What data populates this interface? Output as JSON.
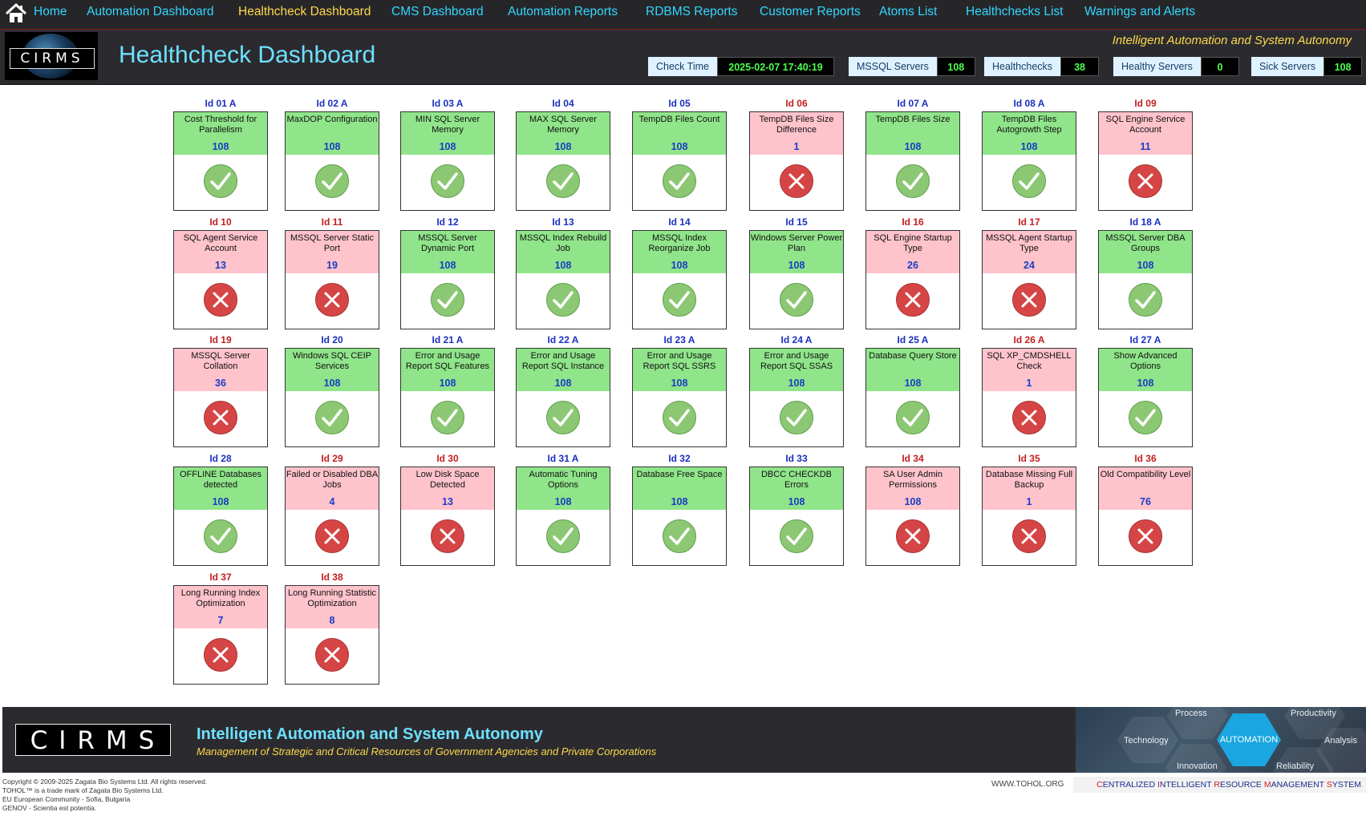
{
  "nav": {
    "items": [
      {
        "label": "Home",
        "active": false
      },
      {
        "label": "Automation Dashboard",
        "active": false
      },
      {
        "label": "Healthcheck Dashboard",
        "active": true
      },
      {
        "label": "CMS Dashboard",
        "active": false
      },
      {
        "label": "Automation Reports",
        "active": false
      },
      {
        "label": "RDBMS Reports",
        "active": false
      },
      {
        "label": "Customer Reports",
        "active": false
      },
      {
        "label": "Atoms List",
        "active": false
      },
      {
        "label": "Healthchecks List",
        "active": false
      },
      {
        "label": "Warnings and Alerts",
        "active": false
      }
    ]
  },
  "header": {
    "logo_text": "CIRMS",
    "title": "Healthcheck Dashboard",
    "tagline": "Intelligent Automation and System Autonomy",
    "stats": [
      {
        "label": "Check Time",
        "value": "2025-02-07 17:40:19"
      },
      {
        "label": "MSSQL Servers",
        "value": "108"
      },
      {
        "label": "Healthchecks",
        "value": "38"
      },
      {
        "label": "Healthy Servers",
        "value": "0"
      },
      {
        "label": "Sick Servers",
        "value": "108"
      }
    ]
  },
  "colors": {
    "ok_header": "#90e58a",
    "bad_header": "#ffc3cc",
    "ok_id": "#1a2fbf",
    "bad_id": "#c21f1f",
    "ok_icon": "#8cc873",
    "bad_icon": "#d64545"
  },
  "checks": [
    {
      "id": "Id 01 A",
      "name": "Cost Threshold for Parallelism",
      "count": "108",
      "status": "ok"
    },
    {
      "id": "Id 02 A",
      "name": "MaxDOP Configuration",
      "count": "108",
      "status": "ok"
    },
    {
      "id": "Id 03 A",
      "name": "MIN SQL Server Memory",
      "count": "108",
      "status": "ok"
    },
    {
      "id": "Id 04",
      "name": "MAX SQL Server Memory",
      "count": "108",
      "status": "ok"
    },
    {
      "id": "Id 05",
      "name": "TempDB Files Count",
      "count": "108",
      "status": "ok"
    },
    {
      "id": "Id 06",
      "name": "TempDB Files Size Difference",
      "count": "1",
      "status": "bad"
    },
    {
      "id": "Id 07 A",
      "name": "TempDB Files Size",
      "count": "108",
      "status": "ok"
    },
    {
      "id": "Id 08 A",
      "name": "TempDB Files Autogrowth Step",
      "count": "108",
      "status": "ok"
    },
    {
      "id": "Id 09",
      "name": "SQL Engine Service Account",
      "count": "11",
      "status": "bad"
    },
    {
      "id": "Id 10",
      "name": "SQL Agent Service Account",
      "count": "13",
      "status": "bad"
    },
    {
      "id": "Id 11",
      "name": "MSSQL Server Static Port",
      "count": "19",
      "status": "bad"
    },
    {
      "id": "Id 12",
      "name": "MSSQL Server Dynamic Port",
      "count": "108",
      "status": "ok"
    },
    {
      "id": "Id 13",
      "name": "MSSQL  Index Rebuild Job",
      "count": "108",
      "status": "ok"
    },
    {
      "id": "Id 14",
      "name": "MSSQL Index Reorganize Job",
      "count": "108",
      "status": "ok"
    },
    {
      "id": "Id 15",
      "name": "Windows Server Power Plan",
      "count": "108",
      "status": "ok"
    },
    {
      "id": "Id 16",
      "name": "SQL Engine Startup Type",
      "count": "26",
      "status": "bad"
    },
    {
      "id": "Id 17",
      "name": "MSSQL Agent Startup Type",
      "count": "24",
      "status": "bad"
    },
    {
      "id": "Id 18 A",
      "name": "MSSQL Server DBA Groups",
      "count": "108",
      "status": "ok"
    },
    {
      "id": "Id 19",
      "name": "MSSQL Server Collation",
      "count": "36",
      "status": "bad"
    },
    {
      "id": "Id 20",
      "name": "Windows SQL CEIP Services",
      "count": "108",
      "status": "ok"
    },
    {
      "id": "Id 21 A",
      "name": "Error and Usage Report SQL Features",
      "count": "108",
      "status": "ok"
    },
    {
      "id": "Id 22 A",
      "name": "Error and Usage Report SQL Instance",
      "count": "108",
      "status": "ok"
    },
    {
      "id": "Id 23 A",
      "name": "Error and Usage Report SQL SSRS",
      "count": "108",
      "status": "ok"
    },
    {
      "id": "Id 24 A",
      "name": "Error and Usage Report SQL SSAS",
      "count": "108",
      "status": "ok"
    },
    {
      "id": "Id 25 A",
      "name": "Database Query Store",
      "count": "108",
      "status": "ok"
    },
    {
      "id": "Id 26 A",
      "name": "SQL XP_CMDSHELL Check",
      "count": "1",
      "status": "bad"
    },
    {
      "id": "Id 27 A",
      "name": "Show Advanced Options",
      "count": "108",
      "status": "ok"
    },
    {
      "id": "Id 28",
      "name": "OFFLINE Databases detected",
      "count": "108",
      "status": "ok"
    },
    {
      "id": "Id 29",
      "name": "Failed or Disabled DBA Jobs",
      "count": "4",
      "status": "bad"
    },
    {
      "id": "Id 30",
      "name": "Low Disk Space Detected",
      "count": "13",
      "status": "bad"
    },
    {
      "id": "Id 31 A",
      "name": "Automatic Tuning Options",
      "count": "108",
      "status": "ok"
    },
    {
      "id": "Id 32",
      "name": "Database Free Space",
      "count": "108",
      "status": "ok"
    },
    {
      "id": "Id 33",
      "name": "DBCC CHECKDB Errors",
      "count": "108",
      "status": "ok"
    },
    {
      "id": "Id 34",
      "name": "SA User Admin Permissions",
      "count": "108",
      "status": "bad"
    },
    {
      "id": "Id 35",
      "name": "Database Missing Full Backup",
      "count": "1",
      "status": "bad"
    },
    {
      "id": "Id 36",
      "name": "Old Compatibility Level",
      "count": "76",
      "status": "bad"
    },
    {
      "id": "Id 37",
      "name": "Long Running  Index Optimization",
      "count": "7",
      "status": "bad"
    },
    {
      "id": "Id 38",
      "name": "Long Running Statistic Optimization",
      "count": "8",
      "status": "bad"
    }
  ],
  "footer": {
    "logo_text": "CIRMS",
    "tagline": "Intelligent Automation and System Autonomy",
    "subtitle": "Management of Strategic and Critical Resources of Government Agencies and Private Corporations",
    "graphic_words": {
      "process": "Process",
      "productivity": "Productivity",
      "technology": "Technology",
      "automation": "AUTOMATION",
      "analysis": "Analysis",
      "innovation": "Innovation",
      "reliability": "Reliability"
    },
    "copyright": [
      "Copyright © 2009-2025 Zagata Bio Systems Ltd. All rights reserved.",
      "TOHOL™ is a trade mark of Zagata Bio Systems Ltd.",
      "EU European Community - Sofia, Bulgaria",
      "GENOV - Scientia est potentia."
    ],
    "url": "WWW.TOHOL.ORG",
    "acronym_parts": [
      {
        "text": "C",
        "red": true
      },
      {
        "text": "ENTRALIZED ",
        "red": false
      },
      {
        "text": "I",
        "red": true
      },
      {
        "text": "NTELLIGENT ",
        "red": false
      },
      {
        "text": "R",
        "red": true
      },
      {
        "text": "ESOURCE ",
        "red": false
      },
      {
        "text": "M",
        "red": true
      },
      {
        "text": "ANAGEMENT ",
        "red": false
      },
      {
        "text": "S",
        "red": true
      },
      {
        "text": "YSTEM",
        "red": false
      }
    ]
  }
}
